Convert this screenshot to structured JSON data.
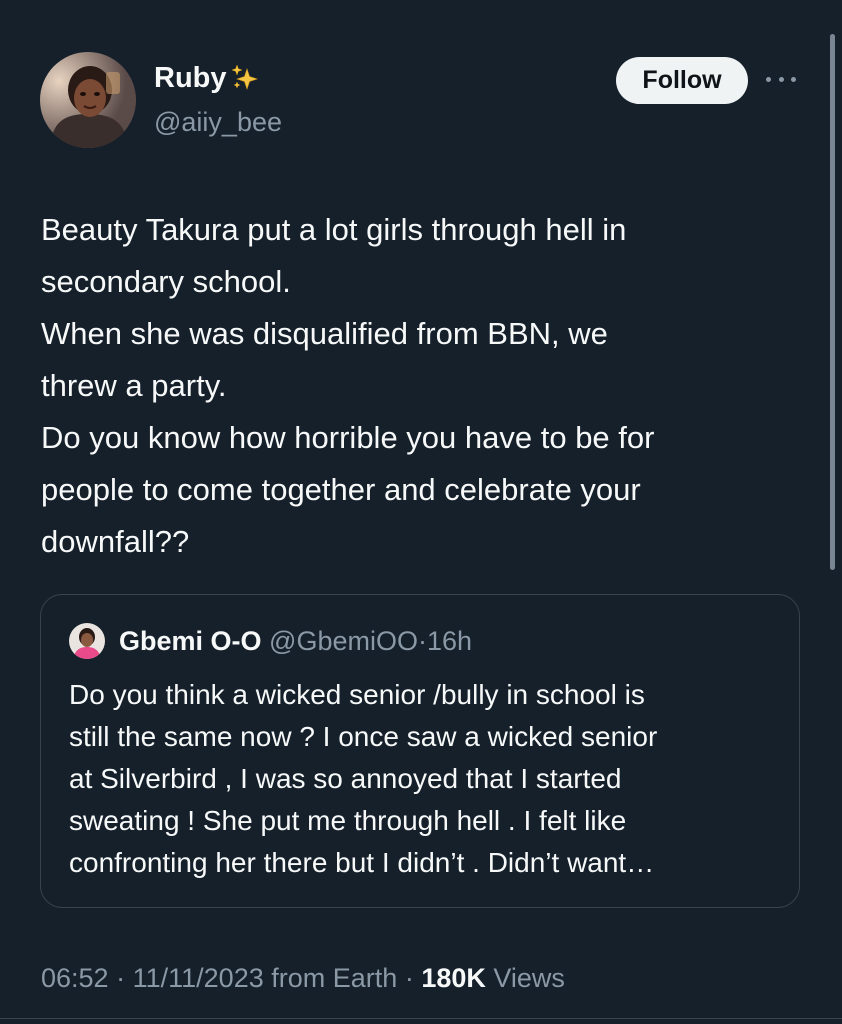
{
  "author": {
    "display_name": "Ruby",
    "handle": "@aiiy_bee",
    "badge_icon": "sparkles-icon"
  },
  "actions": {
    "follow_label": "Follow",
    "more_icon": "more-horizontal-icon"
  },
  "tweet": {
    "lines": [
      "Beauty Takura put a lot girls through hell in",
      "secondary school.",
      "When she was disqualified from BBN, we",
      "threw a party.",
      "Do you know how horrible you have to be for",
      "people to come together and celebrate your",
      "downfall??"
    ]
  },
  "quote": {
    "display_name": "Gbemi O-O",
    "handle": "@GbemiOO",
    "separator": "·",
    "time": "16h",
    "lines": [
      "Do you think a wicked senior /bully in school is",
      "still the same now ? I once saw a wicked senior",
      "at Silverbird , I was so annoyed that I started",
      "sweating ! She put me through hell . I felt like",
      "confronting her there but I didn’t . Didn’t want…"
    ]
  },
  "footer": {
    "time": "06:52",
    "date": "11/11/2023",
    "source": "from Earth",
    "views_count": "180K",
    "views_label": "Views",
    "separator": "·"
  },
  "colors": {
    "background": "#15202b",
    "text_primary": "#f7f9f9",
    "text_secondary": "#8b98a5",
    "border": "#38444d",
    "follow_bg": "#eff3f4"
  }
}
